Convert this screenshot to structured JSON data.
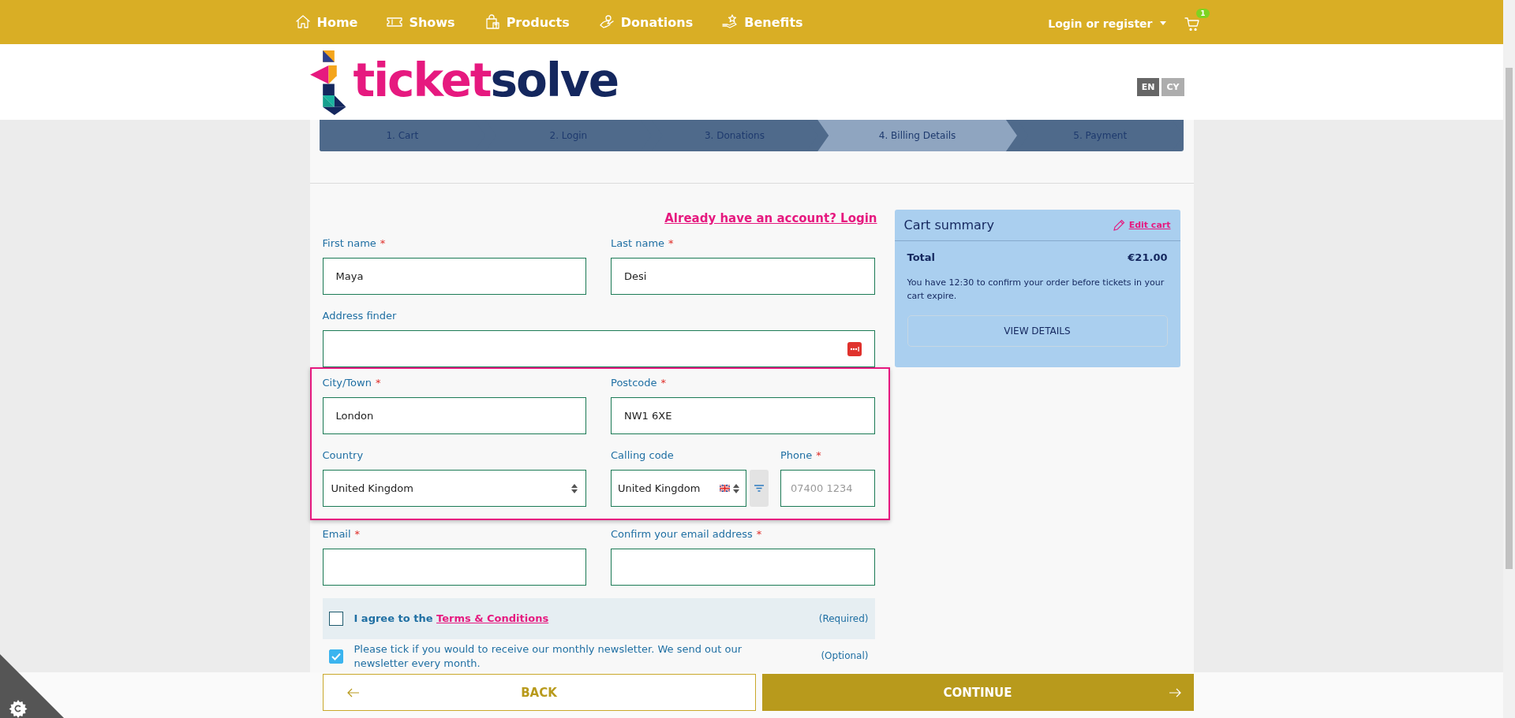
{
  "nav": {
    "items": [
      {
        "label": "Home"
      },
      {
        "label": "Shows"
      },
      {
        "label": "Products"
      },
      {
        "label": "Donations"
      },
      {
        "label": "Benefits"
      }
    ],
    "account": "Login or register",
    "cart_count": "1"
  },
  "header": {
    "logo": {
      "part_1": "ticket",
      "part_2": "solve"
    },
    "languages": [
      {
        "label": "EN",
        "selected": true
      },
      {
        "label": "CY",
        "selected": false
      }
    ]
  },
  "steps": [
    {
      "label": "1. Cart",
      "selected": false
    },
    {
      "label": "2. Login",
      "selected": false
    },
    {
      "label": "3. Donations",
      "selected": false
    },
    {
      "label": "4. Billing Details",
      "selected": true
    },
    {
      "label": "5. Payment",
      "selected": false
    }
  ],
  "form": {
    "login_link": "Already have an account? Login",
    "groups": [
      {
        "highlighted": false,
        "rows": [
          [
            {
              "kind": "text",
              "label": "First name",
              "required_mark": "*",
              "value": "Maya"
            },
            {
              "kind": "text",
              "label": "Last name",
              "required_mark": "*",
              "value": "Desi"
            }
          ],
          [
            {
              "kind": "address",
              "label": "Address finder"
            }
          ]
        ]
      },
      {
        "highlighted": true,
        "rows": [
          [
            {
              "kind": "text",
              "label": "City/Town",
              "required_mark": "*",
              "value": "London"
            },
            {
              "kind": "text",
              "label": "Postcode",
              "required_mark": "*",
              "value": "NW1 6XE"
            }
          ],
          [
            {
              "kind": "select",
              "label": "Country",
              "value": "United Kingdom"
            },
            {
              "kind": "calling_code",
              "label": "Calling code",
              "value": "United Kingdom"
            },
            {
              "kind": "text",
              "label": "Phone",
              "required_mark": "*",
              "placeholder": "07400 1234"
            }
          ]
        ]
      },
      {
        "highlighted": false,
        "rows": [
          [
            {
              "kind": "text",
              "label": "Email",
              "required_mark": "*"
            },
            {
              "kind": "text",
              "label": "Confirm your email address",
              "required_mark": "*"
            }
          ]
        ]
      }
    ],
    "consents": [
      {
        "kind": "terms",
        "text": "I agree to the",
        "link": "Terms & Conditions",
        "note": "(Required)",
        "checked": false
      },
      {
        "kind": "newsletter",
        "text": "Please tick if you would to receive our monthly newsletter. We send out our newsletter every month.",
        "note": "(Optional)",
        "checked": true
      }
    ]
  },
  "cart_summary": {
    "title": "Cart summary",
    "edit_link": "Edit cart",
    "total_label": "Total",
    "total_value": "€21.00",
    "message": "You have 12:30 to confirm your order before tickets in your cart expire.",
    "button": "VIEW DETAILS"
  },
  "footer_buttons": {
    "back": "BACK",
    "continue": "CONTINUE"
  }
}
